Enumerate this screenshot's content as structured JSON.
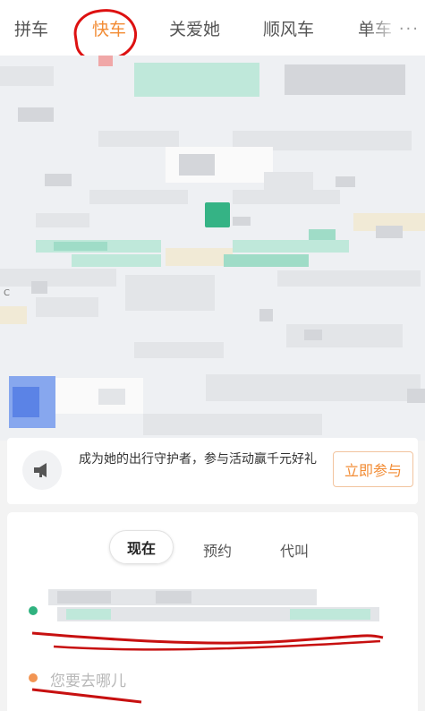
{
  "tabs": [
    {
      "label": "拼车",
      "active": false
    },
    {
      "label": "快车",
      "active": true
    },
    {
      "label": "关爱她",
      "active": false
    },
    {
      "label": "顺风车",
      "active": false
    },
    {
      "label": "单车",
      "active": false
    }
  ],
  "more_label": "···",
  "accent_color": "#f28c35",
  "banner": {
    "text": "成为她的出行守护者，参与活动赢千元好礼",
    "button": "立即参与",
    "icon": "megaphone-icon"
  },
  "time_segments": [
    "现在",
    "预约",
    "代叫"
  ],
  "active_segment": "现在",
  "destination": {
    "placeholder": "您要去哪儿"
  },
  "map": {
    "edge_label": "C"
  }
}
